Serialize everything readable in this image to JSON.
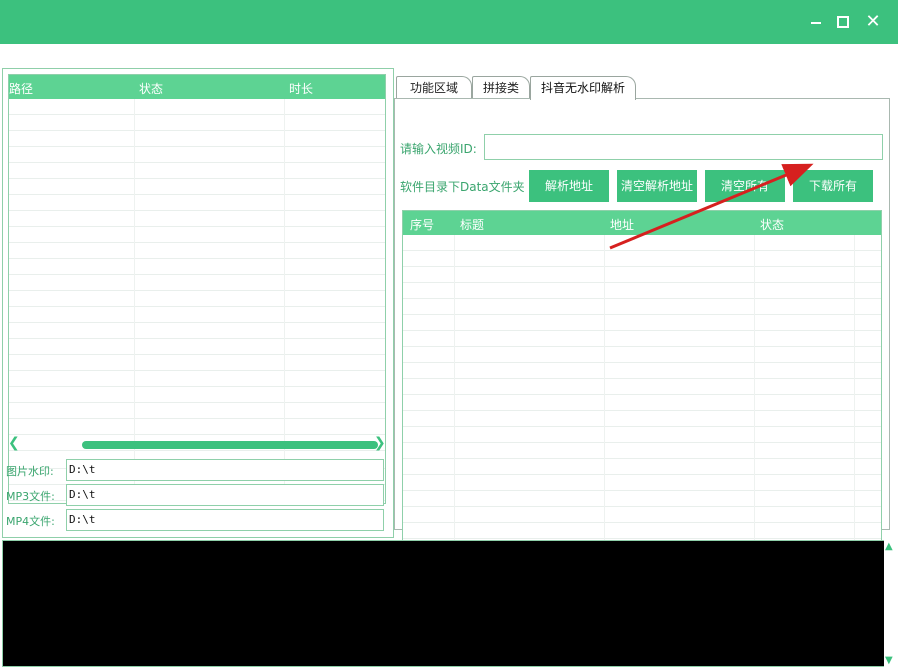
{
  "window": {
    "min_icon": "minimize-icon",
    "max_icon": "maximize-icon",
    "close_icon": "close-icon",
    "close_glyph": "✕"
  },
  "left_grid": {
    "columns": [
      "路径",
      "状态",
      "时长"
    ],
    "scroll_left": "❮",
    "scroll_right": "❯"
  },
  "paths": [
    {
      "label": "图片水印:",
      "value": "D:\\t"
    },
    {
      "label": "MP3文件:",
      "value": "D:\\t"
    },
    {
      "label": "MP4文件:",
      "value": "D:\\t"
    }
  ],
  "tabs": [
    {
      "label": "功能区域"
    },
    {
      "label": "拼接类"
    },
    {
      "label": "抖音无水印解析"
    }
  ],
  "douyin": {
    "id_label": "请输入视频ID:",
    "id_value": "",
    "folder_label": "软件目录下Data文件夹",
    "buttons": [
      "解析地址",
      "清空解析地址",
      "清空所有",
      "下载所有"
    ],
    "columns": [
      "序号",
      "标题",
      "地址",
      "状态"
    ]
  },
  "colors": {
    "accent": "#3cc17e",
    "header": "#5dd393",
    "console": "#000000",
    "annotation_arrow": "#d6201f"
  }
}
